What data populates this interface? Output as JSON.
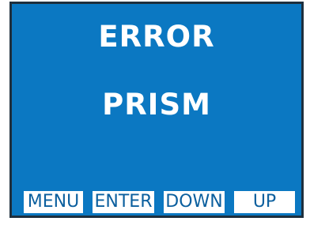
{
  "display": {
    "title": "ERROR",
    "message": "PRISM",
    "background_color": "#0b78c2",
    "text_color": "#ffffff"
  },
  "softkeys": [
    {
      "label": "MENU"
    },
    {
      "label": "ENTER"
    },
    {
      "label": "DOWN"
    },
    {
      "label": "UP"
    }
  ]
}
